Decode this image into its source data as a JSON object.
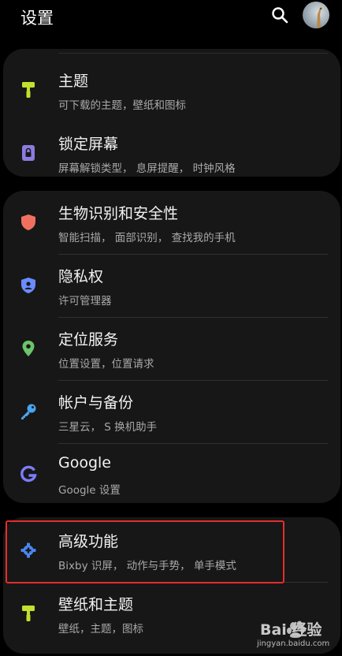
{
  "header": {
    "title": "设置",
    "icons": [
      "search-icon",
      "profile-avatar"
    ]
  },
  "groups": [
    {
      "items": [
        {
          "label": "主题",
          "sub": "可下载的主题，壁纸和图标",
          "icon": "paint-roller-icon",
          "color": "#c3e02c"
        },
        {
          "label": "锁定屏幕",
          "sub": "屏幕解锁类型， 息屏提醒， 时钟风格",
          "icon": "lock-screen-icon",
          "color": "#8c7be0"
        }
      ]
    },
    {
      "items": [
        {
          "label": "生物识别和安全性",
          "sub": "智能扫描， 面部识别， 查找我的手机",
          "icon": "shield-icon",
          "color": "#f07060"
        },
        {
          "label": "隐私权",
          "sub": "许可管理器",
          "icon": "privacy-shield-icon",
          "color": "#6a8cff"
        },
        {
          "label": "定位服务",
          "sub": "位置设置，位置请求",
          "icon": "location-pin-icon",
          "color": "#6cc46a"
        },
        {
          "label": "帐户与备份",
          "sub": "三星云， S 换机助手",
          "icon": "key-icon",
          "color": "#4aa3ee"
        },
        {
          "label": "Google",
          "sub": "Google 设置",
          "icon": "google-icon",
          "color": "#7c7cff"
        }
      ]
    },
    {
      "items": [
        {
          "label": "高级功能",
          "sub": "Bixby 识屏， 动作与手势， 单手模式",
          "icon": "puzzle-gear-icon",
          "color": "#4a86f0"
        },
        {
          "label": "壁纸和主题",
          "sub": "壁纸，主题，图标",
          "icon": "paint-roller-icon",
          "color": "#c3e02c"
        }
      ]
    }
  ],
  "watermark": {
    "text": "Bai 经验",
    "url": "jingyan.baidu.com"
  }
}
